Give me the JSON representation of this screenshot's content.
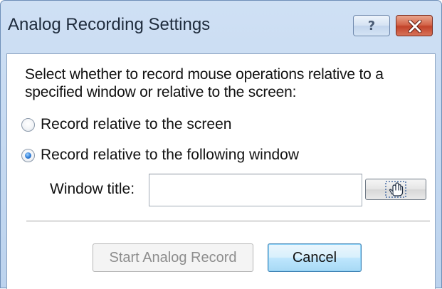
{
  "window": {
    "title": "Analog Recording Settings",
    "help_glyph": "?",
    "help_icon": "question-mark-icon",
    "close_icon": "close-x-icon",
    "accent_close_color": "#c9442b"
  },
  "dialog": {
    "description": "Select whether to record mouse operations relative to a specified window or relative to the screen:",
    "radio_options": [
      {
        "label": "Record relative to the screen",
        "checked": false
      },
      {
        "label": "Record relative to the following window",
        "checked": true
      }
    ],
    "window_title_label": "Window title:",
    "window_title_value": "",
    "picker_icon": "pointing-hand-finder-icon",
    "buttons": {
      "start": "Start Analog Record",
      "start_enabled": false,
      "cancel": "Cancel"
    }
  }
}
